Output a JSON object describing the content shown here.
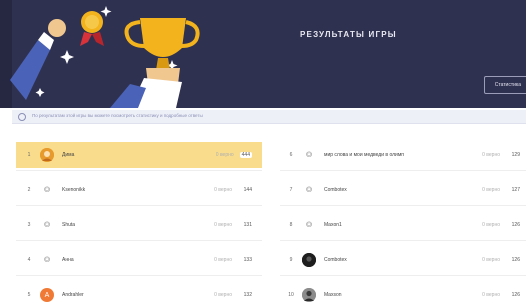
{
  "header": {
    "title": "РЕЗУЛЬТАТЫ ИГРЫ",
    "button_label": "Статистика"
  },
  "notice": {
    "text": "По результатам этой игры вы можете посмотреть статистику и подробные ответы"
  },
  "results": {
    "left": [
      {
        "rank": "1",
        "name": "Дима",
        "meta": "0 верно",
        "score": "444",
        "avatar": "photo-orange",
        "highlight": true
      },
      {
        "rank": "2",
        "name": "Ksenonikk",
        "meta": "0 верно",
        "score": "144",
        "avatar": "default"
      },
      {
        "rank": "3",
        "name": "Shuta",
        "meta": "0 верно",
        "score": "131",
        "avatar": "default"
      },
      {
        "rank": "4",
        "name": "Анна",
        "meta": "0 верно",
        "score": "133",
        "avatar": "default"
      },
      {
        "rank": "5",
        "name": "Andrahler",
        "meta": "0 верно",
        "score": "132",
        "avatar": "letter",
        "letter": "A"
      }
    ],
    "right": [
      {
        "rank": "6",
        "name": "мир слова и мои медведи в олимп",
        "meta": "0 верно",
        "score": "129",
        "avatar": "default"
      },
      {
        "rank": "7",
        "name": "Combotex",
        "meta": "0 верно",
        "score": "127",
        "avatar": "default"
      },
      {
        "rank": "8",
        "name": "Maxon1",
        "meta": "0 верно",
        "score": "126",
        "avatar": "default"
      },
      {
        "rank": "9",
        "name": "Combotex",
        "meta": "0 верно",
        "score": "126",
        "avatar": "photo-dark"
      },
      {
        "rank": "10",
        "name": "Maxson",
        "meta": "0 верно",
        "score": "126",
        "avatar": "photo-gray"
      }
    ]
  },
  "colors": {
    "banner": "#2f3150",
    "highlight": "#f9dc8c",
    "trophy": "#f2b31c",
    "letter_avatar": "#f07a35"
  }
}
